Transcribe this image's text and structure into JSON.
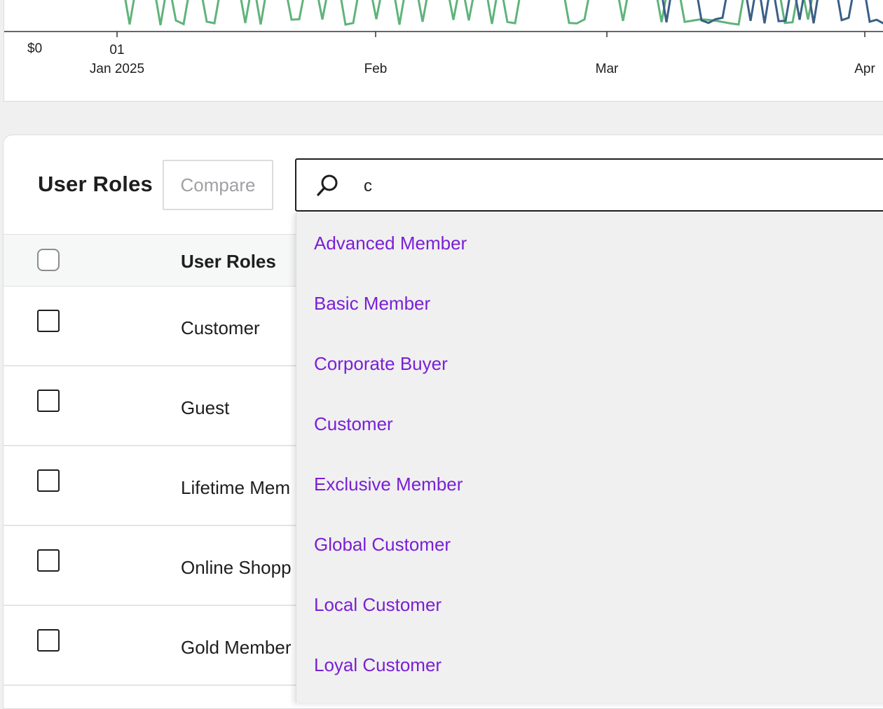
{
  "chart": {
    "y_tick_label": "$0",
    "x_ticks": [
      {
        "line1": "01",
        "line2": "Jan 2025"
      },
      {
        "line1": "Feb"
      },
      {
        "line1": "Mar"
      },
      {
        "line1": "Apr"
      }
    ],
    "series_colors": {
      "primary": "#5fb37a",
      "secondary": "#3a5f85"
    }
  },
  "chart_data": {
    "type": "line",
    "x": [
      "Jan 2025",
      "Feb",
      "Mar",
      "Apr"
    ],
    "series": [
      {
        "color": "#5fb37a",
        "note": "values above visible area, only lower troughs shown"
      },
      {
        "color": "#3a5f85"
      }
    ],
    "ylabel": "",
    "y_tick_labels": [
      "$0"
    ]
  },
  "table": {
    "title": "User Roles",
    "compare_label": "Compare",
    "column_header": "User Roles",
    "rows": [
      {
        "label": "Customer"
      },
      {
        "label": "Guest"
      },
      {
        "label": "Lifetime Mem"
      },
      {
        "label": "Online Shopp"
      },
      {
        "label": "Gold Member"
      }
    ]
  },
  "search": {
    "value": "c",
    "options": [
      "Advanced Member",
      "Basic Member",
      "Corporate Buyer",
      "Customer",
      "Exclusive Member",
      "Global Customer",
      "Local Customer",
      "Loyal Customer"
    ]
  },
  "colors": {
    "accent": "#7a1fd6",
    "line_green": "#5fb37a",
    "line_blue": "#3a5f85"
  }
}
